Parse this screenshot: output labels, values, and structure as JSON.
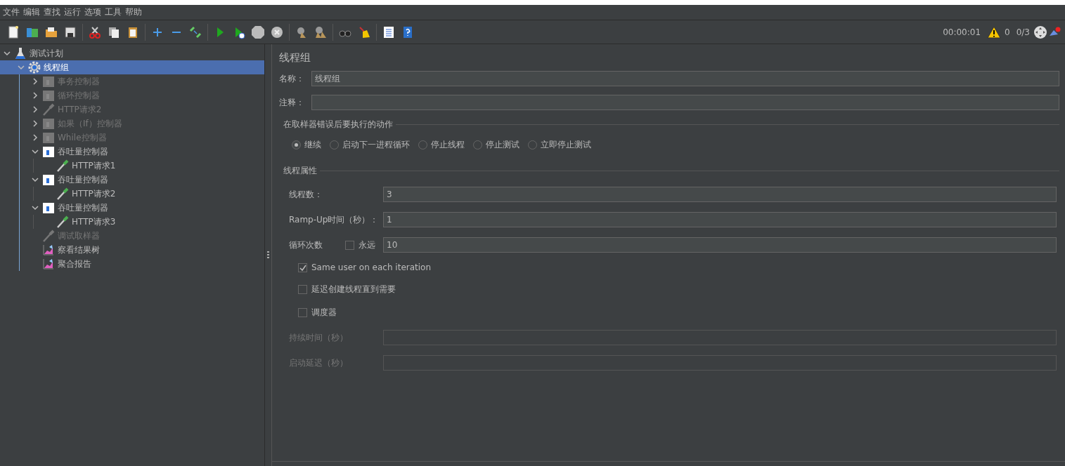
{
  "menu": [
    "文件",
    "编辑",
    "查找",
    "运行",
    "选项",
    "工具",
    "帮助"
  ],
  "status": {
    "elapsed": "00:00:01",
    "error_count": "0",
    "active_threads": "0/3"
  },
  "tree": [
    {
      "label": "测试计划",
      "kind": "plan",
      "expanded": true,
      "selected": false,
      "disabled": false,
      "children": [
        {
          "label": "线程组",
          "kind": "threadgroup",
          "expanded": true,
          "selected": true,
          "disabled": false,
          "children": [
            {
              "label": "事务控制器",
              "kind": "controller",
              "expanded": false,
              "selected": false,
              "disabled": true
            },
            {
              "label": "循环控制器",
              "kind": "controller",
              "expanded": false,
              "selected": false,
              "disabled": true
            },
            {
              "label": "HTTP请求2",
              "kind": "sampler",
              "expanded": false,
              "selected": false,
              "disabled": true
            },
            {
              "label": "如果（If）控制器",
              "kind": "controller",
              "expanded": false,
              "selected": false,
              "disabled": true
            },
            {
              "label": "While控制器",
              "kind": "controller",
              "expanded": false,
              "selected": false,
              "disabled": true
            },
            {
              "label": "吞吐量控制器",
              "kind": "controller",
              "expanded": true,
              "selected": false,
              "disabled": false,
              "children": [
                {
                  "label": "HTTP请求1",
                  "kind": "sampler",
                  "selected": false,
                  "disabled": false
                }
              ]
            },
            {
              "label": "吞吐量控制器",
              "kind": "controller",
              "expanded": true,
              "selected": false,
              "disabled": false,
              "children": [
                {
                  "label": "HTTP请求2",
                  "kind": "sampler",
                  "selected": false,
                  "disabled": false
                }
              ]
            },
            {
              "label": "吞吐量控制器",
              "kind": "controller",
              "expanded": true,
              "selected": false,
              "disabled": false,
              "children": [
                {
                  "label": "HTTP请求3",
                  "kind": "sampler",
                  "selected": false,
                  "disabled": false
                }
              ]
            },
            {
              "label": "调试取样器",
              "kind": "sampler",
              "selected": false,
              "disabled": true
            },
            {
              "label": "察看结果树",
              "kind": "listener",
              "selected": false,
              "disabled": false
            },
            {
              "label": "聚合报告",
              "kind": "listener",
              "selected": false,
              "disabled": false
            }
          ]
        }
      ]
    }
  ],
  "panel": {
    "title": "线程组",
    "name_label": "名称：",
    "name_value": "线程组",
    "comment_label": "注释：",
    "error_action": {
      "legend": "在取样器错误后要执行的动作",
      "options": [
        {
          "label": "继续",
          "selected": true
        },
        {
          "label": "启动下一进程循环",
          "selected": false
        },
        {
          "label": "停止线程",
          "selected": false
        },
        {
          "label": "停止测试",
          "selected": false
        },
        {
          "label": "立即停止测试",
          "selected": false
        }
      ]
    },
    "thread_props": {
      "legend": "线程属性",
      "rows": [
        {
          "kind": "field",
          "label": "线程数：",
          "value": "3",
          "disabled": false
        },
        {
          "kind": "field",
          "label": "Ramp-Up时间（秒）：",
          "value": "1",
          "disabled": false
        },
        {
          "kind": "loop",
          "label": "循环次数",
          "forever_label": "永远",
          "forever_checked": false,
          "value": "10"
        },
        {
          "kind": "checkbox",
          "label": "Same user on each iteration",
          "checked": true
        },
        {
          "kind": "checkbox",
          "label": "延迟创建线程直到需要",
          "checked": false
        },
        {
          "kind": "checkbox",
          "label": "调度器",
          "checked": false
        },
        {
          "kind": "field",
          "label": "持续时间（秒）",
          "value": "",
          "disabled": true
        },
        {
          "kind": "field",
          "label": "启动延迟（秒）",
          "value": "",
          "disabled": true
        }
      ]
    }
  }
}
